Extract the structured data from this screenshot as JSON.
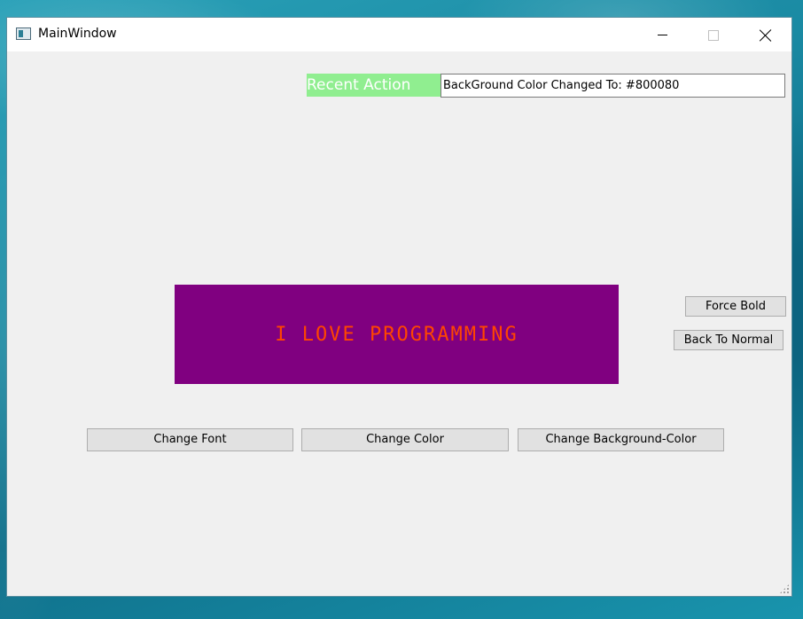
{
  "window": {
    "title": "MainWindow"
  },
  "recent_action": {
    "label": "Recent Action",
    "value": "BackGround Color Changed To: #800080"
  },
  "display": {
    "text": "I LOVE PROGRAMMING",
    "background_color": "#800080",
    "text_color": "#ff4500"
  },
  "buttons": {
    "force_bold": "Force Bold",
    "back_to_normal": "Back To Normal",
    "change_font": "Change Font",
    "change_color": "Change Color",
    "change_background_color": "Change Background-Color"
  },
  "icons": {
    "app": "app-window-icon",
    "minimize": "minimize-icon",
    "maximize": "maximize-icon",
    "close": "close-icon",
    "resize": "resize-grip-icon"
  }
}
